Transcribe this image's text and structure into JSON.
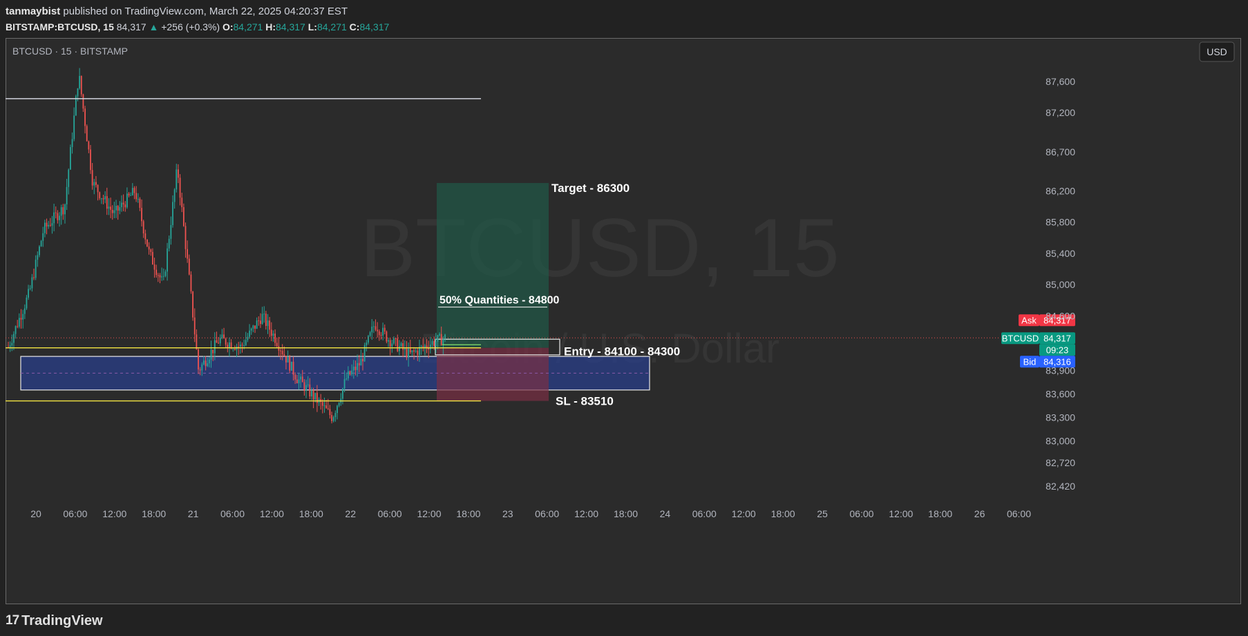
{
  "header": {
    "author": "tanmaybist",
    "published_text": "published on TradingView.com, March 22, 2025 04:20:37 EST",
    "symbol": "BITSTAMP:BTCUSD, 15",
    "last": "84,317",
    "change": "+256 (+0.3%)",
    "o_label": "O:",
    "o": "84,271",
    "h_label": "H:",
    "h": "84,317",
    "l_label": "L:",
    "l": "84,271",
    "c_label": "C:",
    "c": "84,317"
  },
  "footer": {
    "brand": "TradingView",
    "logo": "17"
  },
  "colors": {
    "up": "#26a69a",
    "down": "#ef5350",
    "ask": "#f23645",
    "bid": "#2962ff",
    "zone_blue": "#2a3f8a",
    "target_green": "#1f5c4a",
    "sl_red": "#7a2f45",
    "level_yellow": "#f5e642"
  },
  "chart_data": {
    "type": "candlestick",
    "title": "BTCUSD · 15 · BITSTAMP",
    "watermark_symbol": "BTCUSD, 15",
    "watermark_name": "Bitcoin / U.S. Dollar",
    "currency": "USD",
    "x_ticks": [
      "20",
      "06:00",
      "12:00",
      "18:00",
      "21",
      "06:00",
      "12:00",
      "18:00",
      "22",
      "06:00",
      "12:00",
      "18:00",
      "23",
      "06:00",
      "12:00",
      "18:00",
      "24",
      "06:00",
      "12:00",
      "18:00",
      "25",
      "06:00",
      "12:00",
      "18:00",
      "26",
      "06:00"
    ],
    "y_ticks": [
      "87,600",
      "87,200",
      "86,700",
      "86,200",
      "85,800",
      "85,400",
      "85,000",
      "84,600",
      "83,900",
      "83,600",
      "83,300",
      "83,000",
      "82,720",
      "82,420"
    ],
    "ylim": [
      82200,
      88000
    ],
    "approx_close_path": [
      {
        "t": 0,
        "v": 84200
      },
      {
        "t": 3,
        "v": 84900
      },
      {
        "t": 5,
        "v": 85700
      },
      {
        "t": 8,
        "v": 86000
      },
      {
        "t": 10,
        "v": 87700
      },
      {
        "t": 12,
        "v": 86300
      },
      {
        "t": 15,
        "v": 85900
      },
      {
        "t": 18,
        "v": 86200
      },
      {
        "t": 20,
        "v": 85400
      },
      {
        "t": 22,
        "v": 85000
      },
      {
        "t": 24,
        "v": 86500
      },
      {
        "t": 26,
        "v": 84800
      },
      {
        "t": 27,
        "v": 83900
      },
      {
        "t": 30,
        "v": 84300
      },
      {
        "t": 33,
        "v": 84200
      },
      {
        "t": 36,
        "v": 84600
      },
      {
        "t": 38,
        "v": 84300
      },
      {
        "t": 41,
        "v": 83800
      },
      {
        "t": 44,
        "v": 83500
      },
      {
        "t": 46,
        "v": 83300
      },
      {
        "t": 48,
        "v": 83800
      },
      {
        "t": 50,
        "v": 84000
      },
      {
        "t": 52,
        "v": 84500
      },
      {
        "t": 54,
        "v": 84300
      },
      {
        "t": 57,
        "v": 84100
      },
      {
        "t": 60,
        "v": 84250
      },
      {
        "t": 62,
        "v": 84317
      }
    ],
    "levels": [
      {
        "name": "prior-high-line",
        "value": 87380,
        "color": "#d1d4dc"
      },
      {
        "name": "entry-upper-line",
        "value": 84190,
        "color": "#f5e642"
      },
      {
        "name": "sl-line",
        "value": 83510,
        "color": "#f5e642"
      }
    ],
    "zones": [
      {
        "name": "demand-zone",
        "from": 83650,
        "to": 84080,
        "color": "#2a3f8a"
      },
      {
        "name": "target-zone",
        "from": 84190,
        "to": 86300,
        "color": "#1f5c4a"
      },
      {
        "name": "stop-zone",
        "from": 83510,
        "to": 84190,
        "color": "#7a2f45"
      }
    ],
    "annotations": {
      "target": "Target - 86300",
      "half_qty": "50% Quantities - 84800",
      "entry": "Entry - 84100 - 84300",
      "sl": "SL - 83510"
    },
    "price_tags": {
      "ask_label": "Ask",
      "ask": "84,317",
      "symbol_label": "BTCUSD",
      "last": "84,317",
      "countdown": "09:23",
      "bid_label": "Bid",
      "bid": "84,316"
    }
  }
}
